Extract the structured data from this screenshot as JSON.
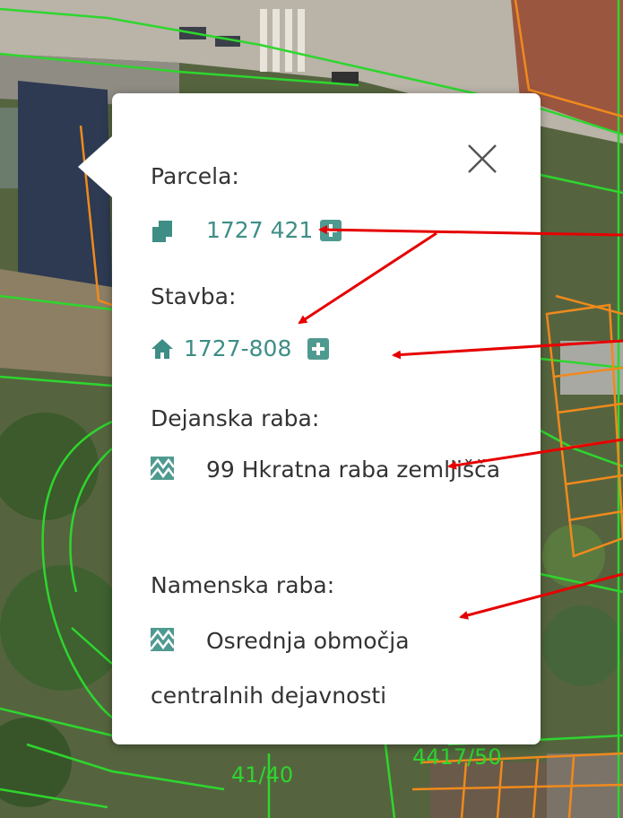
{
  "map": {
    "parcel_labels": [
      "41/40",
      "4417/50"
    ],
    "colors": {
      "parcel_line": "#2ed62e",
      "building_line": "#f08a1c",
      "arrow": "#e60000"
    }
  },
  "popup": {
    "close_icon": "close-icon",
    "parcela": {
      "label": "Parcela:",
      "value": "1727 421",
      "icon": "parcel-icon"
    },
    "stavba": {
      "label": "Stavba:",
      "value": "1727-808",
      "icon": "house-icon"
    },
    "dejanska": {
      "label": "Dejanska raba:",
      "value": "99 Hkratna raba zemljišča",
      "icon": "land-use-icon"
    },
    "namenska": {
      "label": "Namenska raba:",
      "value": "Osrednja območja centralnih dejavnosti",
      "icon": "land-use-icon"
    }
  }
}
